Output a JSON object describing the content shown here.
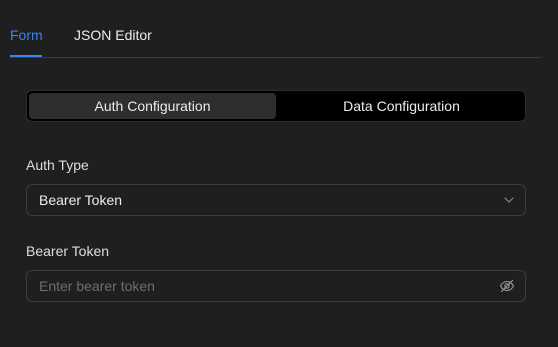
{
  "tabs": {
    "form": "Form",
    "json_editor": "JSON Editor",
    "active": "Form"
  },
  "segmented": {
    "auth": "Auth Configuration",
    "data": "Data Configuration",
    "active": "Auth Configuration"
  },
  "auth_type": {
    "label": "Auth Type",
    "value": "Bearer Token"
  },
  "bearer_token": {
    "label": "Bearer Token",
    "placeholder": "Enter bearer token",
    "value": ""
  },
  "colors": {
    "background": "#1f1f1f",
    "accent": "#3b82f6",
    "segment_background": "#000000",
    "segment_active": "#2e2e2e",
    "border": "#3d3d3d"
  },
  "icons": {
    "select": "chevron-down-icon",
    "password_toggle": "eye-off-icon"
  }
}
